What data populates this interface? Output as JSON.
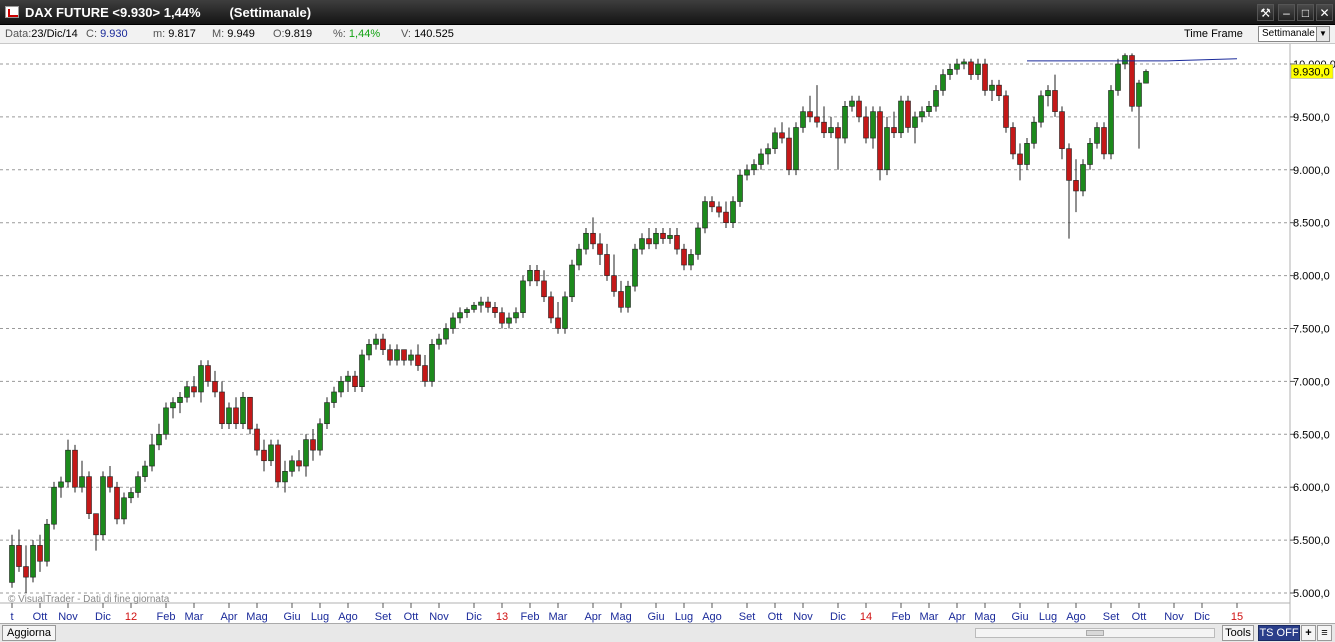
{
  "window": {
    "title": "DAX FUTURE <9.930> 1,44%        (Settimanale)",
    "buttons": [
      "⚒",
      "–",
      "□",
      "✕"
    ]
  },
  "infobar": {
    "data_label": "Data:",
    "data_value": "23/Dic/14",
    "close_label": "C:",
    "close_value": "9.930",
    "min_label": "m:",
    "min_value": "9.817",
    "max_label": "M:",
    "max_value": "9.949",
    "open_label": "O:",
    "open_value": "9.819",
    "pct_label": "%:",
    "pct_value": "1,44%",
    "vol_label": "V:",
    "vol_value": "140.525",
    "timeframe_label": "Time Frame",
    "timeframe_value": "Settimanale"
  },
  "footer": {
    "refresh_label": "Aggiorna",
    "tools_label": "Tools",
    "ts_label": "TS OFF",
    "plus_label": "+",
    "menu_label": "≡"
  },
  "colors": {
    "up": "#1c8a1c",
    "down": "#c41818",
    "trendline": "#1a2a9a",
    "price_badge": "#ffff00"
  },
  "chart_data": {
    "type": "candlestick",
    "watermark": "© VisualTrader - Dati di fine giornata",
    "last_price_label": "9.930,0",
    "ylim": [
      4900,
      10150
    ],
    "yticks": [
      5000,
      5500,
      6000,
      6500,
      7000,
      7500,
      8000,
      8500,
      9000,
      9500,
      10000
    ],
    "ytick_labels": [
      "5.000,0",
      "5.500,0",
      "6.000,0",
      "6.500,0",
      "7.000,0",
      "7.500,0",
      "8.000,0",
      "8.500,0",
      "9.000,0",
      "9.500,0",
      "10.000,0"
    ],
    "xticks": [
      {
        "label": "t",
        "i": 0,
        "year": false
      },
      {
        "label": "Ott",
        "i": 4,
        "year": false
      },
      {
        "label": "Nov",
        "i": 8,
        "year": false
      },
      {
        "label": "Dic",
        "i": 13,
        "year": false
      },
      {
        "label": "12",
        "i": 17,
        "year": true
      },
      {
        "label": "Feb",
        "i": 22,
        "year": false
      },
      {
        "label": "Mar",
        "i": 26,
        "year": false
      },
      {
        "label": "Apr",
        "i": 31,
        "year": false
      },
      {
        "label": "Mag",
        "i": 35,
        "year": false
      },
      {
        "label": "Giu",
        "i": 40,
        "year": false
      },
      {
        "label": "Lug",
        "i": 44,
        "year": false
      },
      {
        "label": "Ago",
        "i": 48,
        "year": false
      },
      {
        "label": "Set",
        "i": 53,
        "year": false
      },
      {
        "label": "Ott",
        "i": 57,
        "year": false
      },
      {
        "label": "Nov",
        "i": 61,
        "year": false
      },
      {
        "label": "Dic",
        "i": 66,
        "year": false
      },
      {
        "label": "13",
        "i": 70,
        "year": true
      },
      {
        "label": "Feb",
        "i": 74,
        "year": false
      },
      {
        "label": "Mar",
        "i": 78,
        "year": false
      },
      {
        "label": "Apr",
        "i": 83,
        "year": false
      },
      {
        "label": "Mag",
        "i": 87,
        "year": false
      },
      {
        "label": "Giu",
        "i": 92,
        "year": false
      },
      {
        "label": "Lug",
        "i": 96,
        "year": false
      },
      {
        "label": "Ago",
        "i": 100,
        "year": false
      },
      {
        "label": "Set",
        "i": 105,
        "year": false
      },
      {
        "label": "Ott",
        "i": 109,
        "year": false
      },
      {
        "label": "Nov",
        "i": 113,
        "year": false
      },
      {
        "label": "Dic",
        "i": 118,
        "year": false
      },
      {
        "label": "14",
        "i": 122,
        "year": true
      },
      {
        "label": "Feb",
        "i": 127,
        "year": false
      },
      {
        "label": "Mar",
        "i": 131,
        "year": false
      },
      {
        "label": "Apr",
        "i": 135,
        "year": false
      },
      {
        "label": "Mag",
        "i": 139,
        "year": false
      },
      {
        "label": "Giu",
        "i": 144,
        "year": false
      },
      {
        "label": "Lug",
        "i": 148,
        "year": false
      },
      {
        "label": "Ago",
        "i": 152,
        "year": false
      },
      {
        "label": "Set",
        "i": 157,
        "year": false
      },
      {
        "label": "Ott",
        "i": 161,
        "year": false
      },
      {
        "label": "Nov",
        "i": 166,
        "year": false
      },
      {
        "label": "Dic",
        "i": 170,
        "year": false
      },
      {
        "label": "15",
        "i": 175,
        "year": true
      }
    ],
    "candles": [
      [
        5100,
        5550,
        5050,
        5450
      ],
      [
        5450,
        5600,
        5200,
        5250
      ],
      [
        5250,
        5450,
        5000,
        5150
      ],
      [
        5150,
        5500,
        5100,
        5450
      ],
      [
        5450,
        5550,
        5200,
        5300
      ],
      [
        5300,
        5700,
        5250,
        5650
      ],
      [
        5650,
        6050,
        5600,
        6000
      ],
      [
        6000,
        6100,
        5900,
        6050
      ],
      [
        6050,
        6450,
        6000,
        6350
      ],
      [
        6350,
        6400,
        5950,
        6000
      ],
      [
        6000,
        6250,
        5950,
        6100
      ],
      [
        6100,
        6150,
        5700,
        5750
      ],
      [
        5750,
        5750,
        5400,
        5550
      ],
      [
        5550,
        6150,
        5500,
        6100
      ],
      [
        6100,
        6200,
        5950,
        6000
      ],
      [
        6000,
        6050,
        5650,
        5700
      ],
      [
        5700,
        5950,
        5650,
        5900
      ],
      [
        5900,
        6000,
        5850,
        5950
      ],
      [
        5950,
        6150,
        5900,
        6100
      ],
      [
        6100,
        6250,
        6050,
        6200
      ],
      [
        6200,
        6500,
        6150,
        6400
      ],
      [
        6400,
        6600,
        6350,
        6500
      ],
      [
        6500,
        6800,
        6450,
        6750
      ],
      [
        6750,
        6850,
        6650,
        6800
      ],
      [
        6800,
        6900,
        6700,
        6850
      ],
      [
        6850,
        7000,
        6800,
        6950
      ],
      [
        6950,
        7050,
        6850,
        6900
      ],
      [
        6900,
        7200,
        6800,
        7150
      ],
      [
        7150,
        7200,
        6950,
        7000
      ],
      [
        7000,
        7100,
        6850,
        6900
      ],
      [
        6900,
        7000,
        6550,
        6600
      ],
      [
        6600,
        6800,
        6550,
        6750
      ],
      [
        6750,
        6850,
        6550,
        6600
      ],
      [
        6600,
        6900,
        6550,
        6850
      ],
      [
        6850,
        6850,
        6500,
        6550
      ],
      [
        6550,
        6600,
        6300,
        6350
      ],
      [
        6350,
        6450,
        6150,
        6250
      ],
      [
        6250,
        6450,
        6200,
        6400
      ],
      [
        6400,
        6450,
        6000,
        6050
      ],
      [
        6050,
        6250,
        5950,
        6150
      ],
      [
        6150,
        6300,
        6100,
        6250
      ],
      [
        6250,
        6350,
        6150,
        6200
      ],
      [
        6200,
        6500,
        6100,
        6450
      ],
      [
        6450,
        6550,
        6250,
        6350
      ],
      [
        6350,
        6650,
        6300,
        6600
      ],
      [
        6600,
        6850,
        6550,
        6800
      ],
      [
        6800,
        6950,
        6750,
        6900
      ],
      [
        6900,
        7050,
        6850,
        7000
      ],
      [
        7000,
        7100,
        6900,
        7050
      ],
      [
        7050,
        7100,
        6900,
        6950
      ],
      [
        6950,
        7300,
        6900,
        7250
      ],
      [
        7250,
        7400,
        7200,
        7350
      ],
      [
        7350,
        7450,
        7300,
        7400
      ],
      [
        7400,
        7450,
        7250,
        7300
      ],
      [
        7300,
        7350,
        7150,
        7200
      ],
      [
        7200,
        7350,
        7150,
        7300
      ],
      [
        7300,
        7300,
        7150,
        7200
      ],
      [
        7200,
        7300,
        7150,
        7250
      ],
      [
        7250,
        7350,
        7100,
        7150
      ],
      [
        7150,
        7250,
        6950,
        7000
      ],
      [
        7000,
        7400,
        6950,
        7350
      ],
      [
        7350,
        7450,
        7300,
        7400
      ],
      [
        7400,
        7550,
        7350,
        7500
      ],
      [
        7500,
        7650,
        7450,
        7600
      ],
      [
        7600,
        7700,
        7550,
        7650
      ],
      [
        7650,
        7700,
        7600,
        7680
      ],
      [
        7680,
        7750,
        7650,
        7720
      ],
      [
        7720,
        7800,
        7650,
        7750
      ],
      [
        7750,
        7800,
        7650,
        7700
      ],
      [
        7700,
        7750,
        7600,
        7650
      ],
      [
        7650,
        7700,
        7500,
        7550
      ],
      [
        7550,
        7650,
        7500,
        7600
      ],
      [
        7600,
        7700,
        7550,
        7650
      ],
      [
        7650,
        8000,
        7600,
        7950
      ],
      [
        7950,
        8100,
        7900,
        8050
      ],
      [
        8050,
        8100,
        7900,
        7950
      ],
      [
        7950,
        8050,
        7750,
        7800
      ],
      [
        7800,
        7850,
        7550,
        7600
      ],
      [
        7600,
        7750,
        7450,
        7500
      ],
      [
        7500,
        7850,
        7450,
        7800
      ],
      [
        7800,
        8150,
        7750,
        8100
      ],
      [
        8100,
        8300,
        8050,
        8250
      ],
      [
        8250,
        8450,
        8200,
        8400
      ],
      [
        8400,
        8550,
        8250,
        8300
      ],
      [
        8300,
        8400,
        8100,
        8200
      ],
      [
        8200,
        8300,
        7950,
        8000
      ],
      [
        8000,
        8200,
        7800,
        7850
      ],
      [
        7850,
        7950,
        7650,
        7700
      ],
      [
        7700,
        7950,
        7650,
        7900
      ],
      [
        7900,
        8300,
        7850,
        8250
      ],
      [
        8250,
        8400,
        8200,
        8350
      ],
      [
        8350,
        8450,
        8250,
        8300
      ],
      [
        8300,
        8450,
        8250,
        8400
      ],
      [
        8400,
        8450,
        8300,
        8350
      ],
      [
        8350,
        8450,
        8300,
        8380
      ],
      [
        8380,
        8450,
        8200,
        8250
      ],
      [
        8250,
        8300,
        8050,
        8100
      ],
      [
        8100,
        8250,
        8050,
        8200
      ],
      [
        8200,
        8500,
        8150,
        8450
      ],
      [
        8450,
        8750,
        8400,
        8700
      ],
      [
        8700,
        8750,
        8600,
        8650
      ],
      [
        8650,
        8700,
        8550,
        8600
      ],
      [
        8600,
        8700,
        8450,
        8500
      ],
      [
        8500,
        8750,
        8450,
        8700
      ],
      [
        8700,
        9000,
        8650,
        8950
      ],
      [
        8950,
        9050,
        8900,
        9000
      ],
      [
        9000,
        9100,
        8950,
        9050
      ],
      [
        9050,
        9200,
        9000,
        9150
      ],
      [
        9150,
        9250,
        9050,
        9200
      ],
      [
        9200,
        9400,
        9150,
        9350
      ],
      [
        9350,
        9450,
        9250,
        9300
      ],
      [
        9300,
        9400,
        8950,
        9000
      ],
      [
        9000,
        9450,
        8950,
        9400
      ],
      [
        9400,
        9600,
        9350,
        9550
      ],
      [
        9550,
        9700,
        9450,
        9500
      ],
      [
        9500,
        9800,
        9400,
        9450
      ],
      [
        9450,
        9600,
        9300,
        9350
      ],
      [
        9350,
        9500,
        9300,
        9400
      ],
      [
        9400,
        9450,
        9000,
        9300
      ],
      [
        9300,
        9650,
        9250,
        9600
      ],
      [
        9600,
        9700,
        9550,
        9650
      ],
      [
        9650,
        9700,
        9450,
        9500
      ],
      [
        9500,
        9600,
        9250,
        9300
      ],
      [
        9300,
        9600,
        9200,
        9550
      ],
      [
        9550,
        9600,
        8900,
        9000
      ],
      [
        9000,
        9500,
        8950,
        9400
      ],
      [
        9400,
        9550,
        9300,
        9350
      ],
      [
        9350,
        9700,
        9300,
        9650
      ],
      [
        9650,
        9700,
        9350,
        9400
      ],
      [
        9400,
        9550,
        9250,
        9500
      ],
      [
        9500,
        9600,
        9450,
        9550
      ],
      [
        9550,
        9650,
        9500,
        9600
      ],
      [
        9600,
        9800,
        9550,
        9750
      ],
      [
        9750,
        9950,
        9700,
        9900
      ],
      [
        9900,
        10000,
        9850,
        9950
      ],
      [
        9950,
        10050,
        9900,
        10000
      ],
      [
        10000,
        10050,
        9950,
        10020
      ],
      [
        10020,
        10050,
        9850,
        9900
      ],
      [
        9900,
        10050,
        9850,
        10000
      ],
      [
        10000,
        10050,
        9700,
        9750
      ],
      [
        9750,
        9850,
        9650,
        9800
      ],
      [
        9800,
        9850,
        9650,
        9700
      ],
      [
        9700,
        9750,
        9350,
        9400
      ],
      [
        9400,
        9450,
        9100,
        9150
      ],
      [
        9150,
        9250,
        8900,
        9050
      ],
      [
        9050,
        9300,
        9000,
        9250
      ],
      [
        9250,
        9500,
        9200,
        9450
      ],
      [
        9450,
        9750,
        9400,
        9700
      ],
      [
        9700,
        9800,
        9600,
        9750
      ],
      [
        9750,
        9900,
        9500,
        9550
      ],
      [
        9550,
        9600,
        9100,
        9200
      ],
      [
        9200,
        9250,
        8350,
        8900
      ],
      [
        8900,
        9100,
        8600,
        8800
      ],
      [
        8800,
        9100,
        8750,
        9050
      ],
      [
        9050,
        9300,
        9000,
        9250
      ],
      [
        9250,
        9450,
        9200,
        9400
      ],
      [
        9400,
        9450,
        9100,
        9150
      ],
      [
        9150,
        9800,
        9100,
        9750
      ],
      [
        9750,
        10050,
        9700,
        10000
      ],
      [
        10000,
        10100,
        9950,
        10080
      ],
      [
        10080,
        10100,
        9550,
        9600
      ],
      [
        9600,
        9850,
        9200,
        9820
      ],
      [
        9819,
        9949,
        9817,
        9930
      ]
    ],
    "trendline": [
      [
        145,
        10030
      ],
      [
        165,
        10030
      ],
      [
        175,
        10050
      ]
    ]
  }
}
